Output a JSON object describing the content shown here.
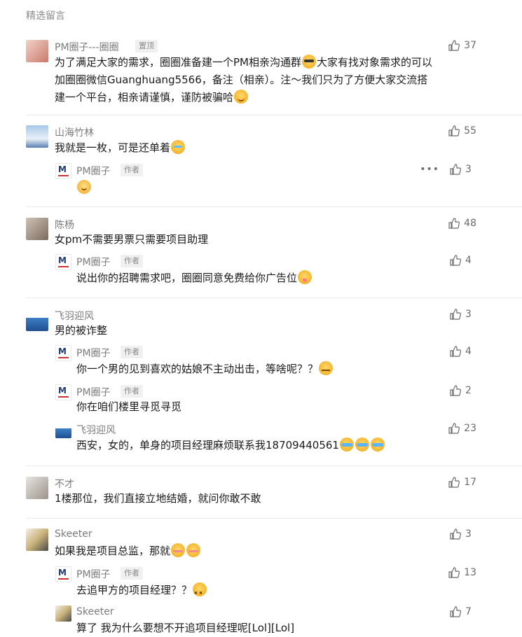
{
  "section_title": "精选留言",
  "colors": {
    "text_primary": "#1a1a1a",
    "text_secondary": "#7b7b7b",
    "badge_bg": "#f0f0f0",
    "divider": "#e9e9e9"
  },
  "icons": {
    "like": "thumbs-up-icon",
    "more": "more-dots-icon"
  },
  "comments": [
    {
      "name": "PM圈子---圈圈",
      "badge": "置顶",
      "likes": "37",
      "lines": [
        "为了满足大家的需求，圈圈准备建一个PM相亲沟通群",
        "大家有找对象需求的可以",
        "加圈圈微信Guanghuang5566，备注（相亲）。注～我们只为了方便大家交流搭",
        "建一个平台，相亲请谨慎，谨防被骗哈"
      ]
    },
    {
      "name": "山海竹林",
      "likes": "55",
      "text": "我就是一枚，可是还单着",
      "reply": {
        "name": "PM圈子",
        "badge": "作者",
        "more": "•••",
        "likes": "3",
        "text": ""
      }
    },
    {
      "name": "陈杨",
      "likes": "48",
      "text": "女pm不需要男票只需要项目助理",
      "reply": {
        "name": "PM圈子",
        "badge": "作者",
        "likes": "4",
        "text": "说出你的招聘需求吧，圈圈同意免费给你广告位"
      }
    },
    {
      "name": "飞羽迎风",
      "likes": "3",
      "text": "男的被诈整",
      "replies": [
        {
          "name": "PM圈子",
          "badge": "作者",
          "likes": "4",
          "text": "你一个男的见到喜欢的姑娘不主动出击，等啥呢？？"
        },
        {
          "name": "PM圈子",
          "badge": "作者",
          "likes": "2",
          "text": "你在咱们楼里寻觅寻觅"
        },
        {
          "name": "飞羽迎风",
          "likes": "23",
          "text": "西安，女的，单身的项目经理麻烦联系我18709440561"
        }
      ]
    },
    {
      "name": "不才",
      "likes": "17",
      "text": "1楼那位，我们直接立地结婚，就问你敢不敢"
    },
    {
      "name": "Skeeter",
      "likes": "3",
      "text": "如果我是项目总监，那就",
      "replies": [
        {
          "name": "PM圈子",
          "badge": "作者",
          "likes": "13",
          "text": "去追甲方的项目经理？？"
        },
        {
          "name": "Skeeter",
          "likes": "7",
          "text": "算了 我为什么要想不开追项目经理呢[Lol][Lol]"
        }
      ]
    }
  ]
}
